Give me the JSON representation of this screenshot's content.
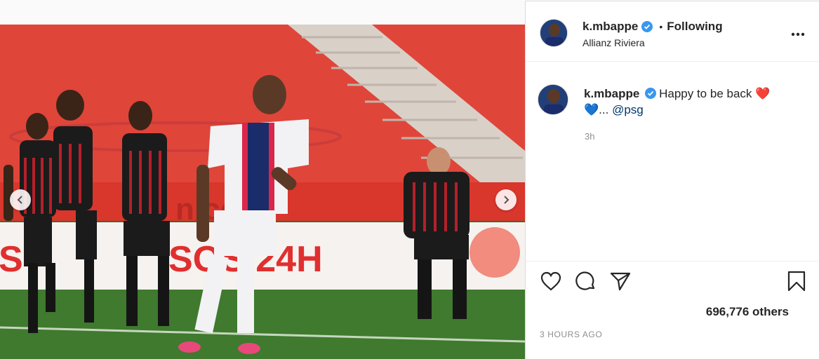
{
  "post": {
    "image_alt": "Mbappe on the pitch in a PSG white kit with Nice players behind",
    "pitch_banner_left": "S",
    "pitch_banner_text": "SOS 24H",
    "stand_text": "nice"
  },
  "header": {
    "username": "k.mbappe",
    "verified_icon": "verified-badge-icon",
    "separator": "•",
    "follow_status": "Following",
    "location": "Allianz Riviera",
    "more_icon": "more-options-icon"
  },
  "caption": {
    "username": "k.mbappe",
    "text": "Happy to be back",
    "heart1": "❤️",
    "heart2": "💙",
    "ellipsis": "...",
    "mention": "@psg",
    "time": "3h"
  },
  "actions": {
    "like_icon": "heart-outline-icon",
    "comment_icon": "comment-icon",
    "share_icon": "share-paper-plane-icon",
    "save_icon": "bookmark-icon"
  },
  "likes_text": "696,776 others",
  "posted_text": "3 HOURS AGO",
  "colors": {
    "verified": "#3897f0",
    "link": "#00376b",
    "muted": "#8e8e8e",
    "border": "#dbdbdb"
  }
}
